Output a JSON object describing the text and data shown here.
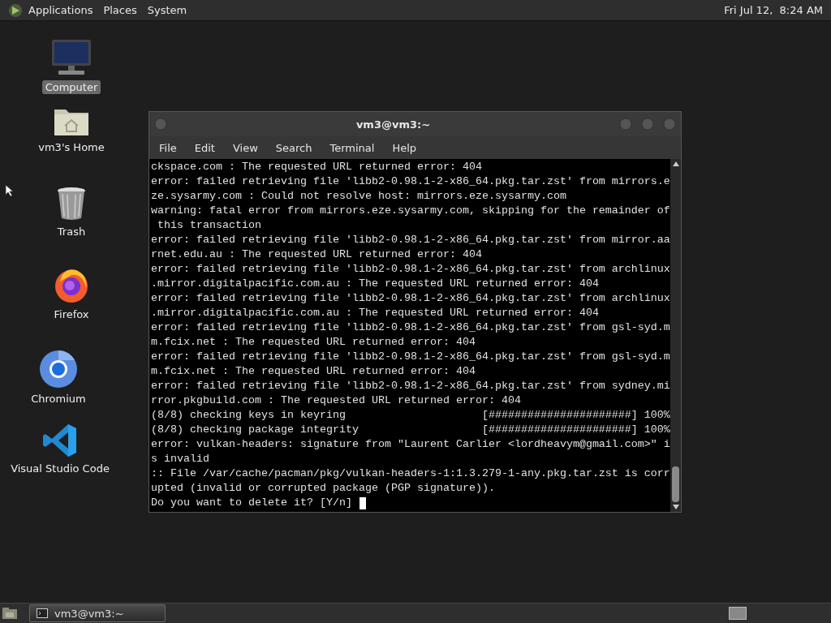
{
  "top_panel": {
    "menus": [
      "Applications",
      "Places",
      "System"
    ],
    "clock": "Fri Jul 12,  8:24 AM"
  },
  "desktop_icons": [
    {
      "kind": "computer",
      "label": "Computer",
      "selected": true
    },
    {
      "kind": "home",
      "label": "vm3's Home",
      "selected": false
    },
    {
      "kind": "trash",
      "label": "Trash",
      "selected": false
    },
    {
      "kind": "firefox",
      "label": "Firefox",
      "selected": false
    },
    {
      "kind": "chromium",
      "label": "Chromium",
      "selected": false
    },
    {
      "kind": "vscode",
      "label": "Visual Studio Code",
      "selected": false
    }
  ],
  "window": {
    "title": "vm3@vm3:~",
    "menu": [
      "File",
      "Edit",
      "View",
      "Search",
      "Terminal",
      "Help"
    ],
    "terminal_lines": [
      "ckspace.com : The requested URL returned error: 404",
      "error: failed retrieving file 'libb2-0.98.1-2-x86_64.pkg.tar.zst' from mirrors.e",
      "ze.sysarmy.com : Could not resolve host: mirrors.eze.sysarmy.com",
      "warning: fatal error from mirrors.eze.sysarmy.com, skipping for the remainder of",
      " this transaction",
      "error: failed retrieving file 'libb2-0.98.1-2-x86_64.pkg.tar.zst' from mirror.aa",
      "rnet.edu.au : The requested URL returned error: 404",
      "error: failed retrieving file 'libb2-0.98.1-2-x86_64.pkg.tar.zst' from archlinux",
      ".mirror.digitalpacific.com.au : The requested URL returned error: 404",
      "error: failed retrieving file 'libb2-0.98.1-2-x86_64.pkg.tar.zst' from archlinux",
      ".mirror.digitalpacific.com.au : The requested URL returned error: 404",
      "error: failed retrieving file 'libb2-0.98.1-2-x86_64.pkg.tar.zst' from gsl-syd.m",
      "m.fcix.net : The requested URL returned error: 404",
      "error: failed retrieving file 'libb2-0.98.1-2-x86_64.pkg.tar.zst' from gsl-syd.m",
      "m.fcix.net : The requested URL returned error: 404",
      "error: failed retrieving file 'libb2-0.98.1-2-x86_64.pkg.tar.zst' from sydney.mi",
      "rror.pkgbuild.com : The requested URL returned error: 404",
      "(8/8) checking keys in keyring                     [######################] 100%",
      "(8/8) checking package integrity                   [######################] 100%",
      "error: vulkan-headers: signature from \"Laurent Carlier <lordheavym@gmail.com>\" i",
      "s invalid",
      ":: File /var/cache/pacman/pkg/vulkan-headers-1:1.3.279-1-any.pkg.tar.zst is corr",
      "upted (invalid or corrupted package (PGP signature)).",
      "Do you want to delete it? [Y/n] "
    ]
  },
  "taskbar": {
    "tasks": [
      {
        "label": "vm3@vm3:~",
        "selected": true
      }
    ]
  }
}
